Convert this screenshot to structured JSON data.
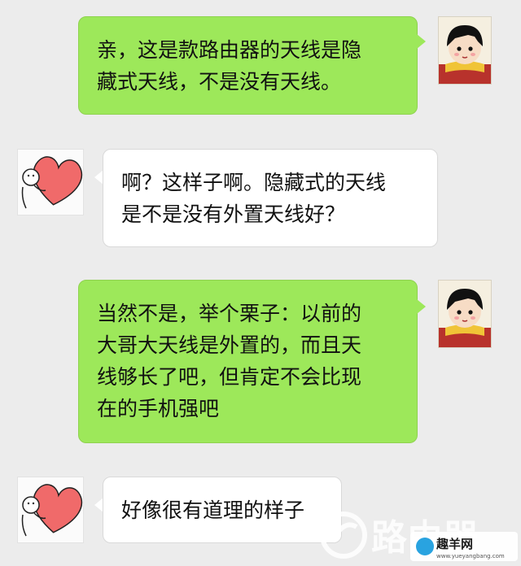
{
  "messages": [
    {
      "side": "right",
      "text": "亲，这是款路由器的天线是隐\n藏式天线，不是没有天线。"
    },
    {
      "side": "left",
      "text": "啊？这样子啊。隐藏式的天线\n是不是没有外置天线好？"
    },
    {
      "side": "right",
      "text": "当然不是，举个栗子：以前的\n大哥大天线是外置的，而且天\n线够长了吧，但肯定不会比现\n在的手机强吧"
    },
    {
      "side": "left",
      "text": "好像很有道理的样子"
    }
  ],
  "avatars": {
    "right": "cartoon-girl-avatar-icon",
    "left": "heart-hug-avatar-icon"
  },
  "watermark": {
    "brand_text": "路由器",
    "site_name": "趣羊网",
    "site_url": "www.yueyangbang.com"
  },
  "colors": {
    "background": "#ececec",
    "bubble_sent": "#9de85a",
    "bubble_received": "#ffffff",
    "heart": "#f06a6a"
  }
}
